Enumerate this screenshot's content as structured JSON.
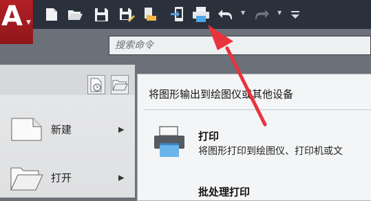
{
  "toolbar": {
    "buttons": [
      {
        "name": "new-icon"
      },
      {
        "name": "open-icon"
      },
      {
        "name": "save-icon"
      },
      {
        "name": "save-as-icon"
      },
      {
        "name": "open-from-web-icon"
      },
      {
        "name": "save-to-web-icon"
      },
      {
        "name": "print-icon"
      },
      {
        "name": "undo-icon"
      },
      {
        "name": "redo-icon"
      },
      {
        "name": "customize-toolbar-icon"
      }
    ]
  },
  "search": {
    "placeholder": "搜索命令"
  },
  "menu": {
    "items": [
      {
        "label": "新建",
        "icon": "new-document-icon",
        "has_submenu": true
      },
      {
        "label": "打开",
        "icon": "open-folder-icon",
        "has_submenu": true
      }
    ]
  },
  "flyout": {
    "title": "将图形输出到绘图仪或其他设备",
    "items": [
      {
        "title": "打印",
        "description": "将图形打印到绘图仪、打印机或文",
        "icon": "printer-icon"
      },
      {
        "title": "批处理打印",
        "description": ""
      }
    ]
  },
  "colors": {
    "toolbar_bg": "#2a313d",
    "app_button": "#b32025",
    "annotation_arrow": "#e8343c"
  }
}
